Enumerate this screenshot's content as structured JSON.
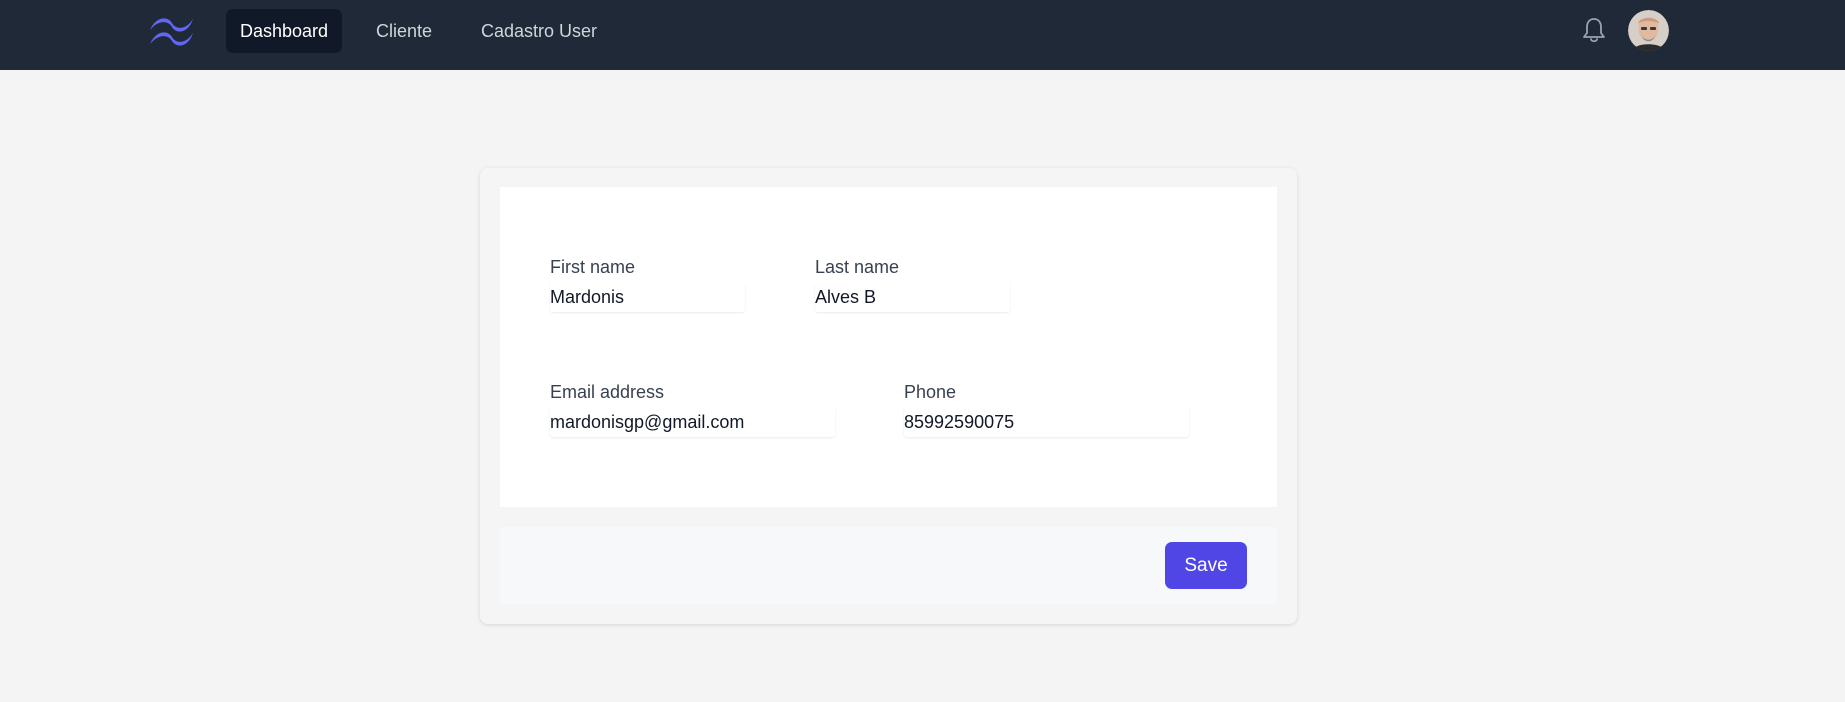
{
  "nav": {
    "items": [
      {
        "label": "Dashboard",
        "active": true
      },
      {
        "label": "Cliente",
        "active": false
      },
      {
        "label": "Cadastro User",
        "active": false
      }
    ],
    "icons": {
      "logo": "wave-logo-icon",
      "notifications": "bell-icon"
    },
    "colors": {
      "bar": "#1f2937",
      "active_item": "#111827",
      "logo": "#6366f1"
    }
  },
  "form": {
    "first_name": {
      "label": "First name",
      "value": "Mardonis"
    },
    "last_name": {
      "label": "Last name",
      "value": "Alves B"
    },
    "email": {
      "label": "Email address",
      "value": "mardonisgp@gmail.com"
    },
    "phone": {
      "label": "Phone",
      "value": "85992590075"
    },
    "save_label": "Save",
    "colors": {
      "accent": "#4f46e5"
    }
  }
}
